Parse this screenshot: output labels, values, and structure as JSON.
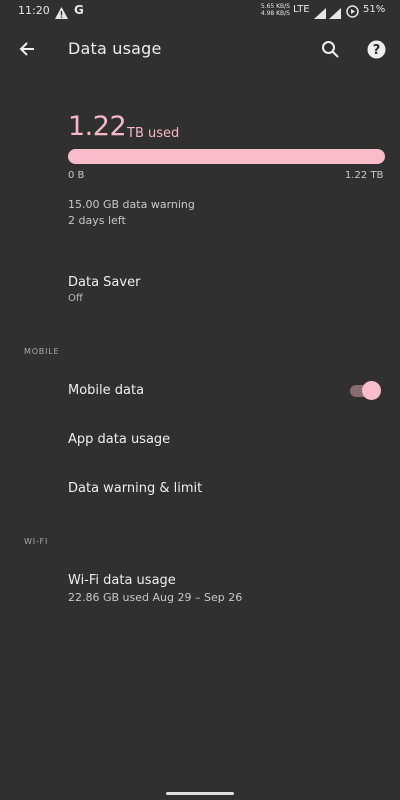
{
  "status_bar": {
    "time": "11:20",
    "net_speed_up": "5.65 KB/S",
    "net_speed_down": "4.98 KB/S",
    "network": "LTE",
    "battery": "51%",
    "icons": [
      "warning-icon",
      "google-icon",
      "wifi-icon",
      "signal-icon",
      "battery-icon"
    ]
  },
  "app_bar": {
    "title": "Data usage",
    "icons": [
      "back-arrow-icon",
      "search-icon",
      "help-icon"
    ]
  },
  "usage": {
    "amount": "1.22",
    "unit": "TB used",
    "fraction": 1.0,
    "min_label": "0 B",
    "max_label": "1.22 TB",
    "warning": "15.00 GB data warning",
    "days_left": "2 days left",
    "accent": "#f8bccb"
  },
  "data_saver": {
    "title": "Data Saver",
    "status": "Off"
  },
  "mobile_section": {
    "header": "MOBILE",
    "mobile_data": {
      "title": "Mobile data",
      "enabled": true
    },
    "app_data_usage": "App data usage",
    "warning_limit": "Data warning & limit"
  },
  "wifi_section": {
    "header": "WI-FI",
    "wifi_usage": {
      "title": "Wi-Fi data usage",
      "detail": "22.86 GB used Aug 29 – Sep 26"
    }
  }
}
